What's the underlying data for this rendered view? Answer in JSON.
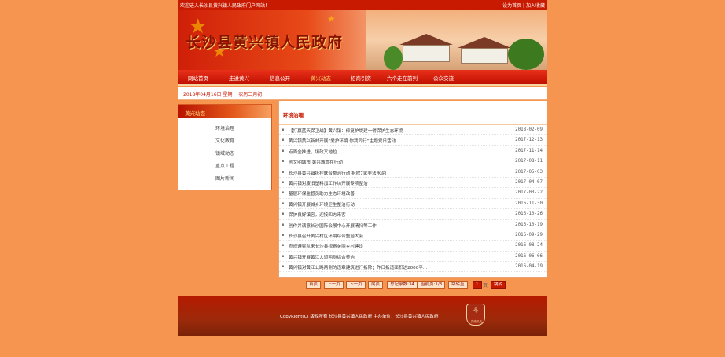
{
  "topbar": {
    "welcome": "欢迎进入长沙县黄兴镇人民政府门户网站！",
    "set_home": "设为首页",
    "separator": "|",
    "add_favorite": "加入收藏"
  },
  "banner": {
    "title": "长沙县黄兴镇人民政府"
  },
  "nav": {
    "items": [
      "网站首页",
      "走进黄兴",
      "信息公开",
      "黄兴动态",
      "招商引资",
      "六个走在前列",
      "公众交流"
    ]
  },
  "datebar": {
    "date": "2018年04月16日 星期一 农历三月初一"
  },
  "sidebar": {
    "heading": "黄兴动态",
    "items": [
      "环境治理",
      "文化教育",
      "镇域动态",
      "重点工程",
      "图片新闻"
    ]
  },
  "main": {
    "heading": "环境治理",
    "articles": [
      {
        "title": "【打赢蓝天保卫战】黄兴镇：修复护堤建一得保护生态环境",
        "date": "2018-02-09"
      },
      {
        "title": "黄兴镇黄兴新村开展“爱护环境 你我同行”主题党日活动",
        "date": "2017-12-13"
      },
      {
        "title": "点面全推进，填政又地拉",
        "date": "2017-11-14"
      },
      {
        "title": "创文明城市 黄兴城管在行动",
        "date": "2017-08-11"
      },
      {
        "title": "长沙县黄兴镇拆控联合整治行动 拆除7家非法水泥厂",
        "date": "2017-05-03"
      },
      {
        "title": "黄兴镇对废旧塑料加工作坊开展专项整治",
        "date": "2017-04-07"
      },
      {
        "title": "基层环保监督员助力生态环境改善",
        "date": "2017-03-22"
      },
      {
        "title": "黄兴镇开展城乡环境卫生整治行动",
        "date": "2016-11-30"
      },
      {
        "title": "保护良好镇容，迎接四方来客",
        "date": "2016-10-26"
      },
      {
        "title": "创作并满意长沙国际会展中心开展清扫等工作",
        "date": "2016-10-19"
      },
      {
        "title": "长沙县召开黄兴村区环境综合整治大会",
        "date": "2016-09-29"
      },
      {
        "title": "查规遵宪队来长沙县视察美丽乡村建设",
        "date": "2016-08-24"
      },
      {
        "title": "黄兴镇开展黄江大道两侧综合整治",
        "date": "2016-06-06"
      },
      {
        "title": "黄兴镇对黄江公路两侧的违章建筑进行拆除；昨日拆违面积达2000平...",
        "date": "2016-04-19"
      }
    ]
  },
  "pager": {
    "first": "首页",
    "prev": "上一页",
    "next": "下一页",
    "last": "尾页",
    "total": "总记录数:34",
    "current": "当前页:1/3",
    "jump": "跳转至",
    "page_number": "1",
    "page_unit": "页",
    "go": "跳转"
  },
  "footer": {
    "copyright": "CopyRight(C) 版权所有 长沙县黄兴镇人民政府 主办单位：长沙县黄兴镇人民政府",
    "emblem_text": "党政机关"
  },
  "colors": {
    "background": "#f6954f",
    "accent": "#c81a00",
    "title_red": "#8a1000"
  }
}
